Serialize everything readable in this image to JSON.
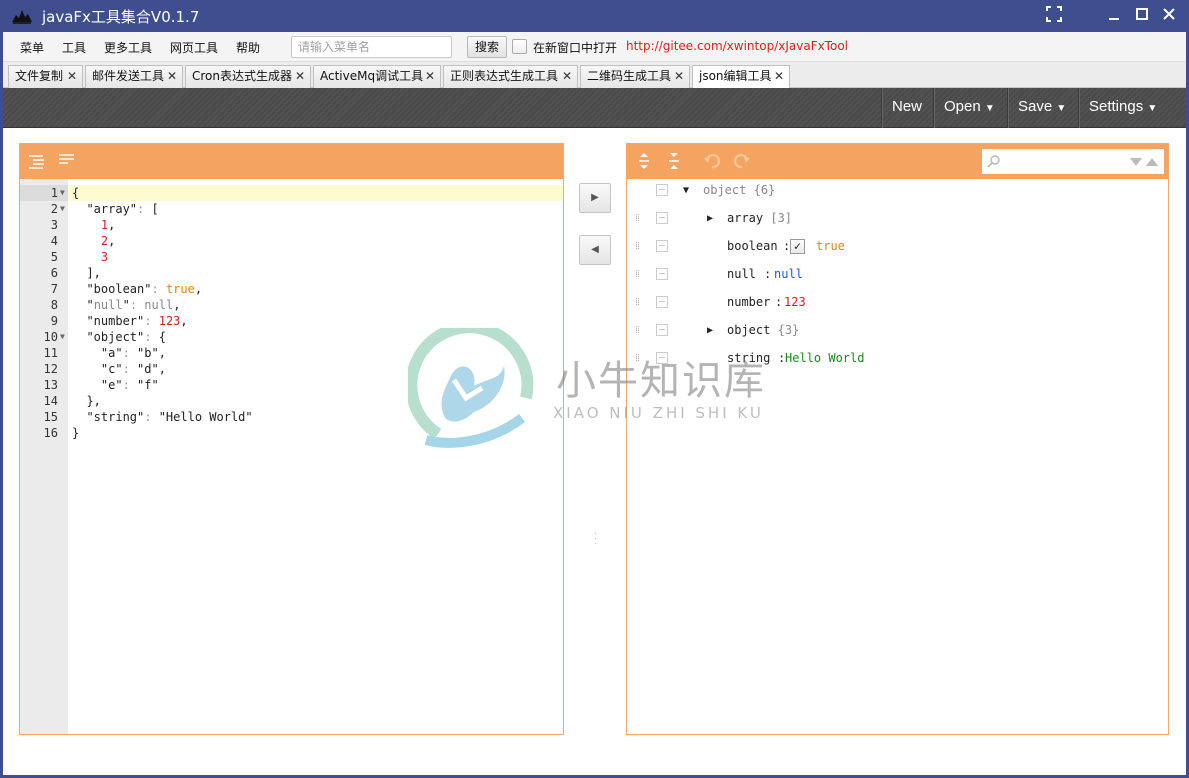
{
  "window": {
    "title": "javaFx工具集合V0.1.7",
    "icons": [
      "app-logo-icon",
      "fullscreen-icon",
      "minimize-icon",
      "maximize-icon",
      "close-icon"
    ]
  },
  "menubar": {
    "items": [
      "菜单",
      "工具",
      "更多工具",
      "网页工具",
      "帮助"
    ],
    "search_placeholder": "请输入菜单名",
    "search_button": "搜索",
    "new_window_label": "在新窗口中打开",
    "new_window_checked": false,
    "link": "http://gitee.com/xwintop/xJavaFxTool"
  },
  "tabs": [
    {
      "label": "文件复制",
      "active": false
    },
    {
      "label": "邮件发送工具",
      "active": false
    },
    {
      "label": "Cron表达式生成器",
      "active": false
    },
    {
      "label": "ActiveMq调试工具",
      "active": false
    },
    {
      "label": "正则表达式生成工具",
      "active": false
    },
    {
      "label": "二维码生成工具",
      "active": false
    },
    {
      "label": "json编辑工具",
      "active": true
    }
  ],
  "toolbar": {
    "buttons": [
      "New",
      "Open",
      "Save",
      "Settings"
    ],
    "dropdown_arrow": "▼"
  },
  "code_editor": {
    "head_icons": [
      "format-icon",
      "compact-icon"
    ],
    "lines": [
      {
        "num": "1",
        "text": "{"
      },
      {
        "num": "2",
        "text": "  \"array\": ["
      },
      {
        "num": "3",
        "text": "    1,"
      },
      {
        "num": "4",
        "text": "    2,"
      },
      {
        "num": "5",
        "text": "    3"
      },
      {
        "num": "6",
        "text": "  ],"
      },
      {
        "num": "7",
        "text": "  \"boolean\": true,"
      },
      {
        "num": "8",
        "text": "  \"null\": null,"
      },
      {
        "num": "9",
        "text": "  \"number\": 123,"
      },
      {
        "num": "10",
        "text": "  \"object\": {"
      },
      {
        "num": "11",
        "text": "    \"a\": \"b\","
      },
      {
        "num": "12",
        "text": "    \"c\": \"d\","
      },
      {
        "num": "13",
        "text": "    \"e\": \"f\""
      },
      {
        "num": "14",
        "text": "  },"
      },
      {
        "num": "15",
        "text": "  \"string\": \"Hello World\""
      },
      {
        "num": "16",
        "text": "}"
      }
    ]
  },
  "transfer": {
    "to_right": "▶",
    "to_left": "◀"
  },
  "tree_editor": {
    "head_icons": [
      "expand-all-icon",
      "collapse-all-icon",
      "undo-icon",
      "redo-icon"
    ],
    "search_placeholder": "",
    "root": {
      "name": "object",
      "meta": "{6}"
    },
    "rows": [
      {
        "key": "array",
        "meta": "[3]",
        "type": "array"
      },
      {
        "key": "boolean",
        "value": "true",
        "type": "boolean",
        "checked": true
      },
      {
        "key": "null",
        "value": "null",
        "type": "null"
      },
      {
        "key": "number",
        "value": "123",
        "type": "number"
      },
      {
        "key": "object",
        "meta": "{3}",
        "type": "object"
      },
      {
        "key": "string",
        "value": "Hello World",
        "type": "string"
      }
    ],
    "separator": ":"
  },
  "watermark": {
    "text_cn": "小牛知识库",
    "text_en": "XIAO NIU ZHI SHI KU"
  },
  "colors": {
    "titlebar": "#3e4e8e",
    "panel_header": "#f4a460",
    "link": "#e31c1c",
    "string": "#1a8b1a",
    "number": "#d02020",
    "boolean": "#e08600",
    "null_tree": "#1a5bd8"
  }
}
